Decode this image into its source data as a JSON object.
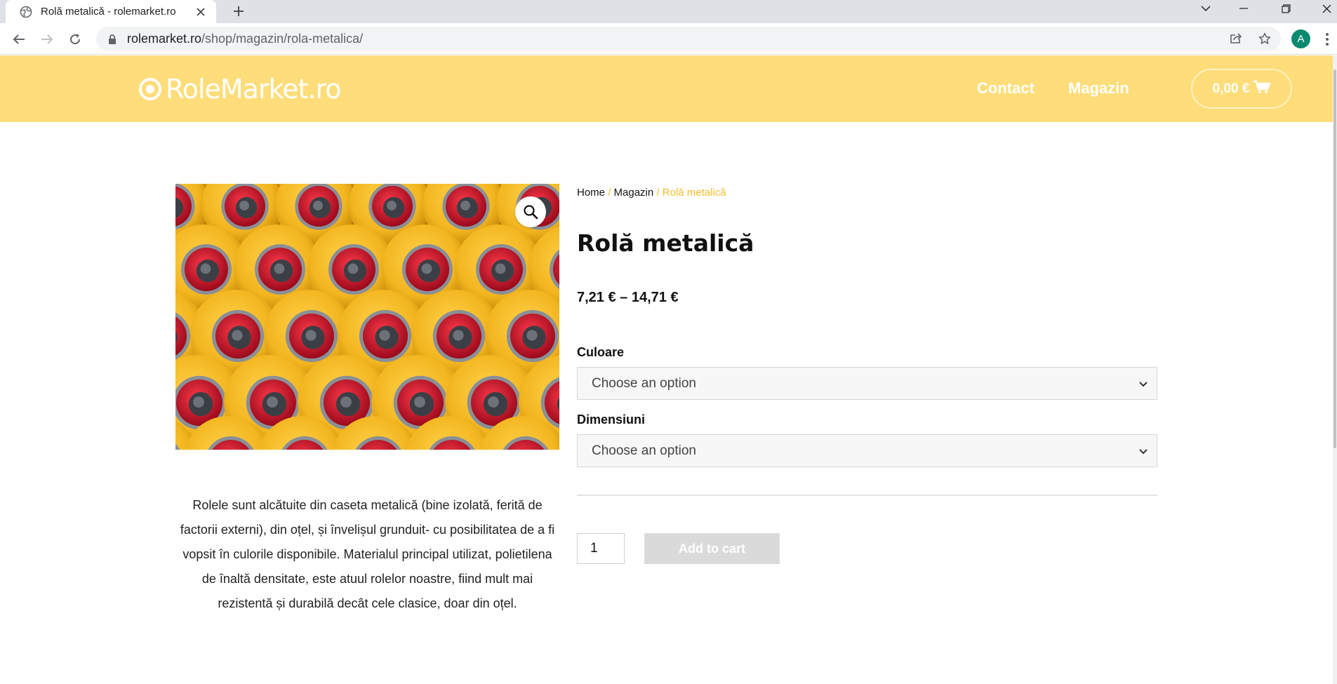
{
  "browser": {
    "tab_title": "Rolă metalică - rolemarket.ro",
    "url_host": "rolemarket.ro",
    "url_path": "/shop/magazin/rola-metalica/",
    "avatar_letter": "A"
  },
  "header": {
    "logo_text": "RoleMarket.ro",
    "nav": [
      "Contact",
      "Magazin"
    ],
    "cart_total": "0,00 €",
    "background": "#fedd7a"
  },
  "breadcrumb": {
    "items": [
      "Home",
      "Magazin"
    ],
    "current": "Rolă metalică",
    "separator": "/"
  },
  "product": {
    "title": "Rolă metalică",
    "price_range": "7,21 € – 14,71 €",
    "description": "Rolele sunt alcătuite din caseta metalică (bine izolată, ferită de factorii externi), din oțel, și învelișul grunduit- cu posibilitatea de a fi vopsit în culorile disponibile. Materialul principal utilizat, polietilena de înaltă densitate, este atuul rolelor noastre, fiind mult mai rezistentă și durabilă decât cele clasice, doar din oțel.",
    "variations": [
      {
        "label": "Culoare",
        "placeholder": "Choose an option"
      },
      {
        "label": "Dimensiuni",
        "placeholder": "Choose an option"
      }
    ],
    "quantity": "1",
    "add_to_cart": "Add to cart"
  },
  "colors": {
    "accent": "#f5bd2c",
    "roller_yellow": "#f2b51f",
    "roller_red": "#c8102e"
  }
}
